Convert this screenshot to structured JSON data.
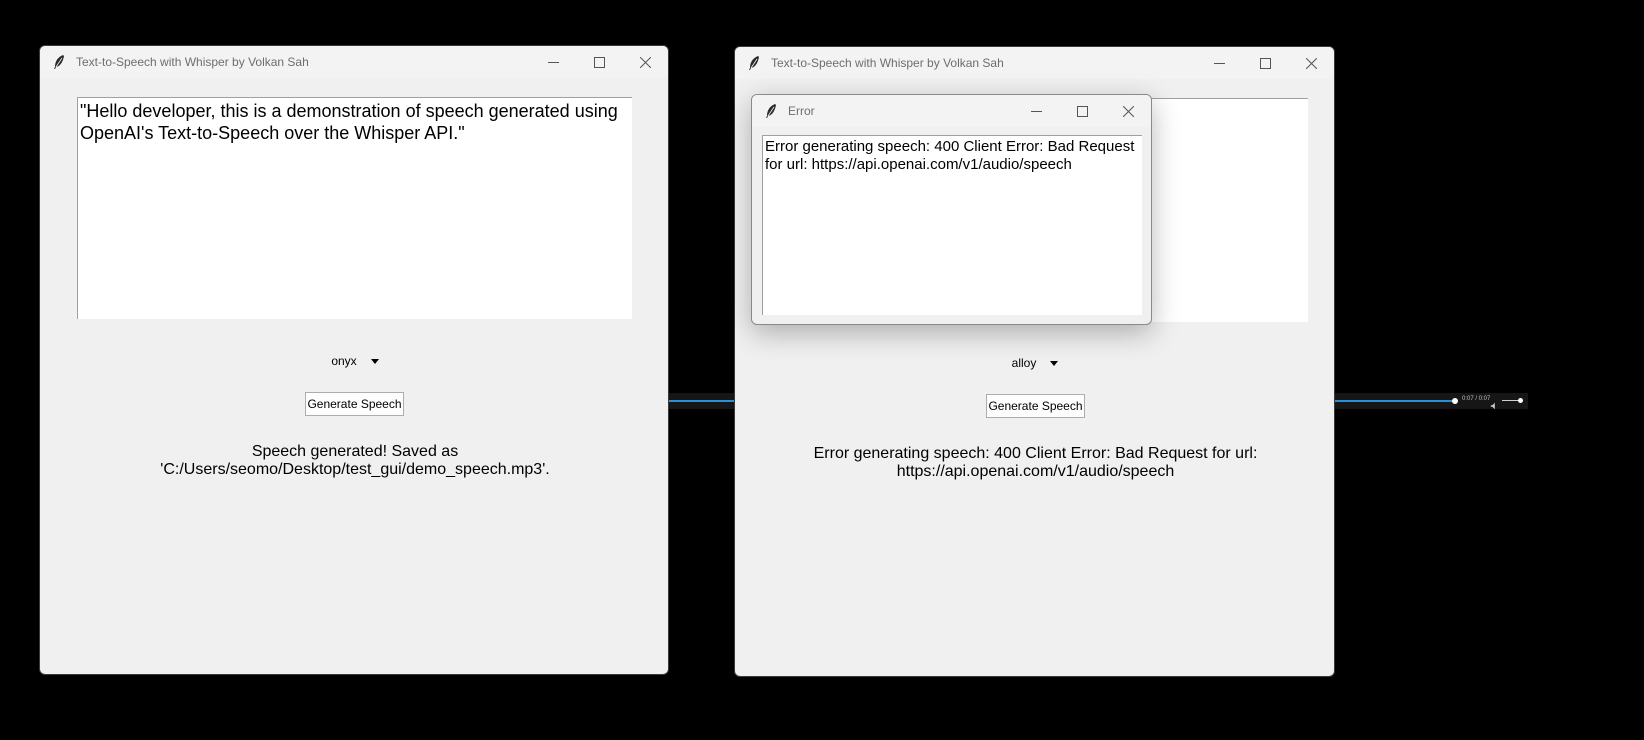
{
  "left_window": {
    "title": "Text-to-Speech with Whisper by Volkan Sah",
    "text_input_value": "\"Hello developer, this is a demonstration of speech generated using OpenAI's Text-to-Speech over the Whisper API.\"",
    "voice_selected": "onyx",
    "generate_button": "Generate Speech",
    "status_line1": "Speech generated! Saved as",
    "status_line2": "'C:/Users/seomo/Desktop/test_gui/demo_speech.mp3'."
  },
  "right_window": {
    "title": "Text-to-Speech with Whisper by Volkan Sah",
    "voice_selected": "alloy",
    "generate_button": "Generate Speech",
    "status_line1": "Error generating speech: 400 Client Error: Bad Request for url:",
    "status_line2": "https://api.openai.com/v1/audio/speech"
  },
  "error_dialog": {
    "title": "Error",
    "message": "Error generating speech: 400 Client Error: Bad Request for url: https://api.openai.com/v1/audio/speech"
  },
  "media_player": {
    "time": "0:07 / 0:07",
    "progress": 1.0
  },
  "icons": {
    "window": "feather-icon",
    "minimize": "minimize-icon",
    "maximize": "maximize-icon",
    "close": "close-icon",
    "volume": "volume-icon"
  },
  "colors": {
    "desktop": "#000000",
    "window_bg": "#f0f0f0",
    "accent": "#2a8fd6"
  }
}
